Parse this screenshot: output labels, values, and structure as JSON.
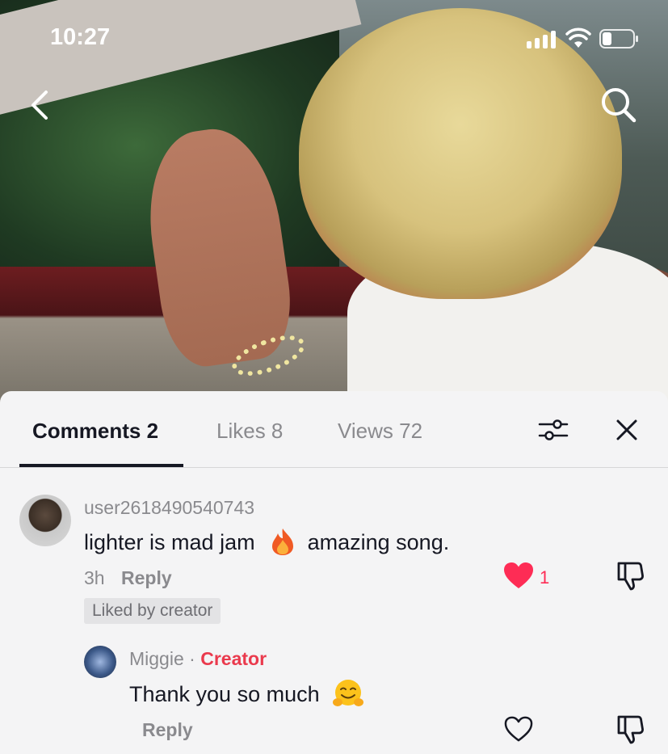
{
  "status_bar": {
    "time": "10:27"
  },
  "tabs": [
    {
      "label": "Comments 2",
      "active": true
    },
    {
      "label": "Likes 8",
      "active": false
    },
    {
      "label": "Views 72",
      "active": false
    }
  ],
  "icons": {
    "back": "chevron-left-icon",
    "search": "search-icon",
    "filter": "sliders-icon",
    "close": "close-icon",
    "heart": "heart-icon",
    "dislike": "thumbs-down-icon"
  },
  "comments": [
    {
      "username": "user2618490540743",
      "text_before": "lighter is mad jam",
      "emoji": "fire-emoji",
      "text_after": "amazing song.",
      "time": "3h",
      "reply_label": "Reply",
      "like_count": "1",
      "liked": true,
      "badge": "Liked by creator",
      "replies": [
        {
          "username": "Miggie",
          "separator": "·",
          "tag": "Creator",
          "text": "Thank you so much",
          "emoji": "hugging-face-emoji",
          "reply_label": "Reply",
          "liked": false
        }
      ]
    }
  ],
  "colors": {
    "accent": "#fe2c55",
    "creator": "#ea3a4d",
    "text": "#161823",
    "muted": "#8a8a8e",
    "sheet_bg": "#f4f4f5"
  }
}
